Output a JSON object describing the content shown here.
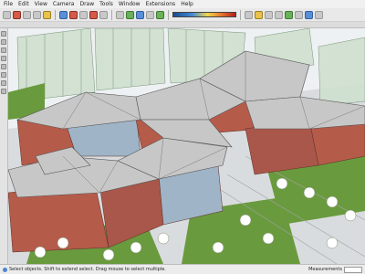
{
  "menubar": {
    "items": [
      "File",
      "Edit",
      "View",
      "Camera",
      "Draw",
      "Tools",
      "Window",
      "Extensions",
      "Help"
    ]
  },
  "toolbar": {
    "icons": [
      "select-tool",
      "eraser-tool",
      "line-tool",
      "arc-tool",
      "rectangle-tool",
      "pushpull-tool",
      "move-tool",
      "rotate-tool",
      "scale-tool",
      "offset-tool",
      "tape-tool",
      "text-tool",
      "orbit-tool",
      "pan-tool",
      "zoom-tool",
      "zoom-extents-tool",
      "shadow-settings",
      "fog-toggle",
      "section-plane",
      "styles",
      "layers"
    ]
  },
  "status": {
    "left_text": "Select objects. Shift to extend select. Drag mouse to select multiple.",
    "measurements_label": "Measurements"
  },
  "colors": {
    "roof": "#bfbfbf",
    "brick": "#b55b4a",
    "glass": "#9fb4c7",
    "grass": "#6a9a3e",
    "ground": "#d9dcde"
  }
}
